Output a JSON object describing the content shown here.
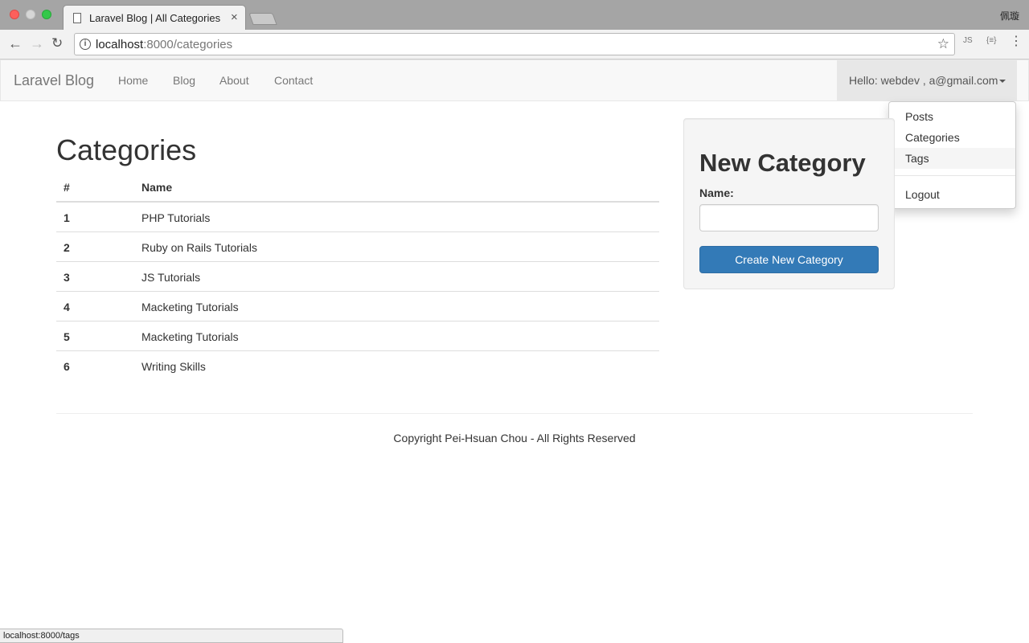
{
  "browser": {
    "tab_title": "Laravel Blog | All Categories",
    "tab_close": "×",
    "profile_name": "佩璇",
    "url_host": "localhost",
    "url_rest": ":8000/categories",
    "info_glyph": "i",
    "back_glyph": "←",
    "forward_glyph": "→",
    "reload_glyph": "↻",
    "star_glyph": "☆",
    "ext1_label": "JS",
    "ext2_label": "{≡}",
    "menu_glyph": "⋮",
    "status_url": "localhost:8000/tags"
  },
  "navbar": {
    "brand": "Laravel Blog",
    "links": [
      "Home",
      "Blog",
      "About",
      "Contact"
    ],
    "user_label": "Hello: webdev , a@gmail.com"
  },
  "dropdown": {
    "items": [
      "Posts",
      "Categories",
      "Tags"
    ],
    "logout": "Logout"
  },
  "main": {
    "title": "Categories",
    "columns": [
      "#",
      "Name"
    ],
    "rows": [
      {
        "id": "1",
        "name": "PHP Tutorials"
      },
      {
        "id": "2",
        "name": "Ruby on Rails Tutorials"
      },
      {
        "id": "3",
        "name": "JS Tutorials"
      },
      {
        "id": "4",
        "name": "Macketing Tutorials"
      },
      {
        "id": "5",
        "name": "Macketing Tutorials"
      },
      {
        "id": "6",
        "name": "Writing Skills"
      }
    ]
  },
  "form": {
    "title": "New Category",
    "name_label": "Name:",
    "name_value": "",
    "submit_label": "Create New Category"
  },
  "footer": {
    "text": "Copyright Pei-Hsuan Chou - All Rights Reserved"
  },
  "colors": {
    "primary": "#337ab7",
    "navbar_bg": "#f8f8f8",
    "well_bg": "#f5f5f5"
  }
}
